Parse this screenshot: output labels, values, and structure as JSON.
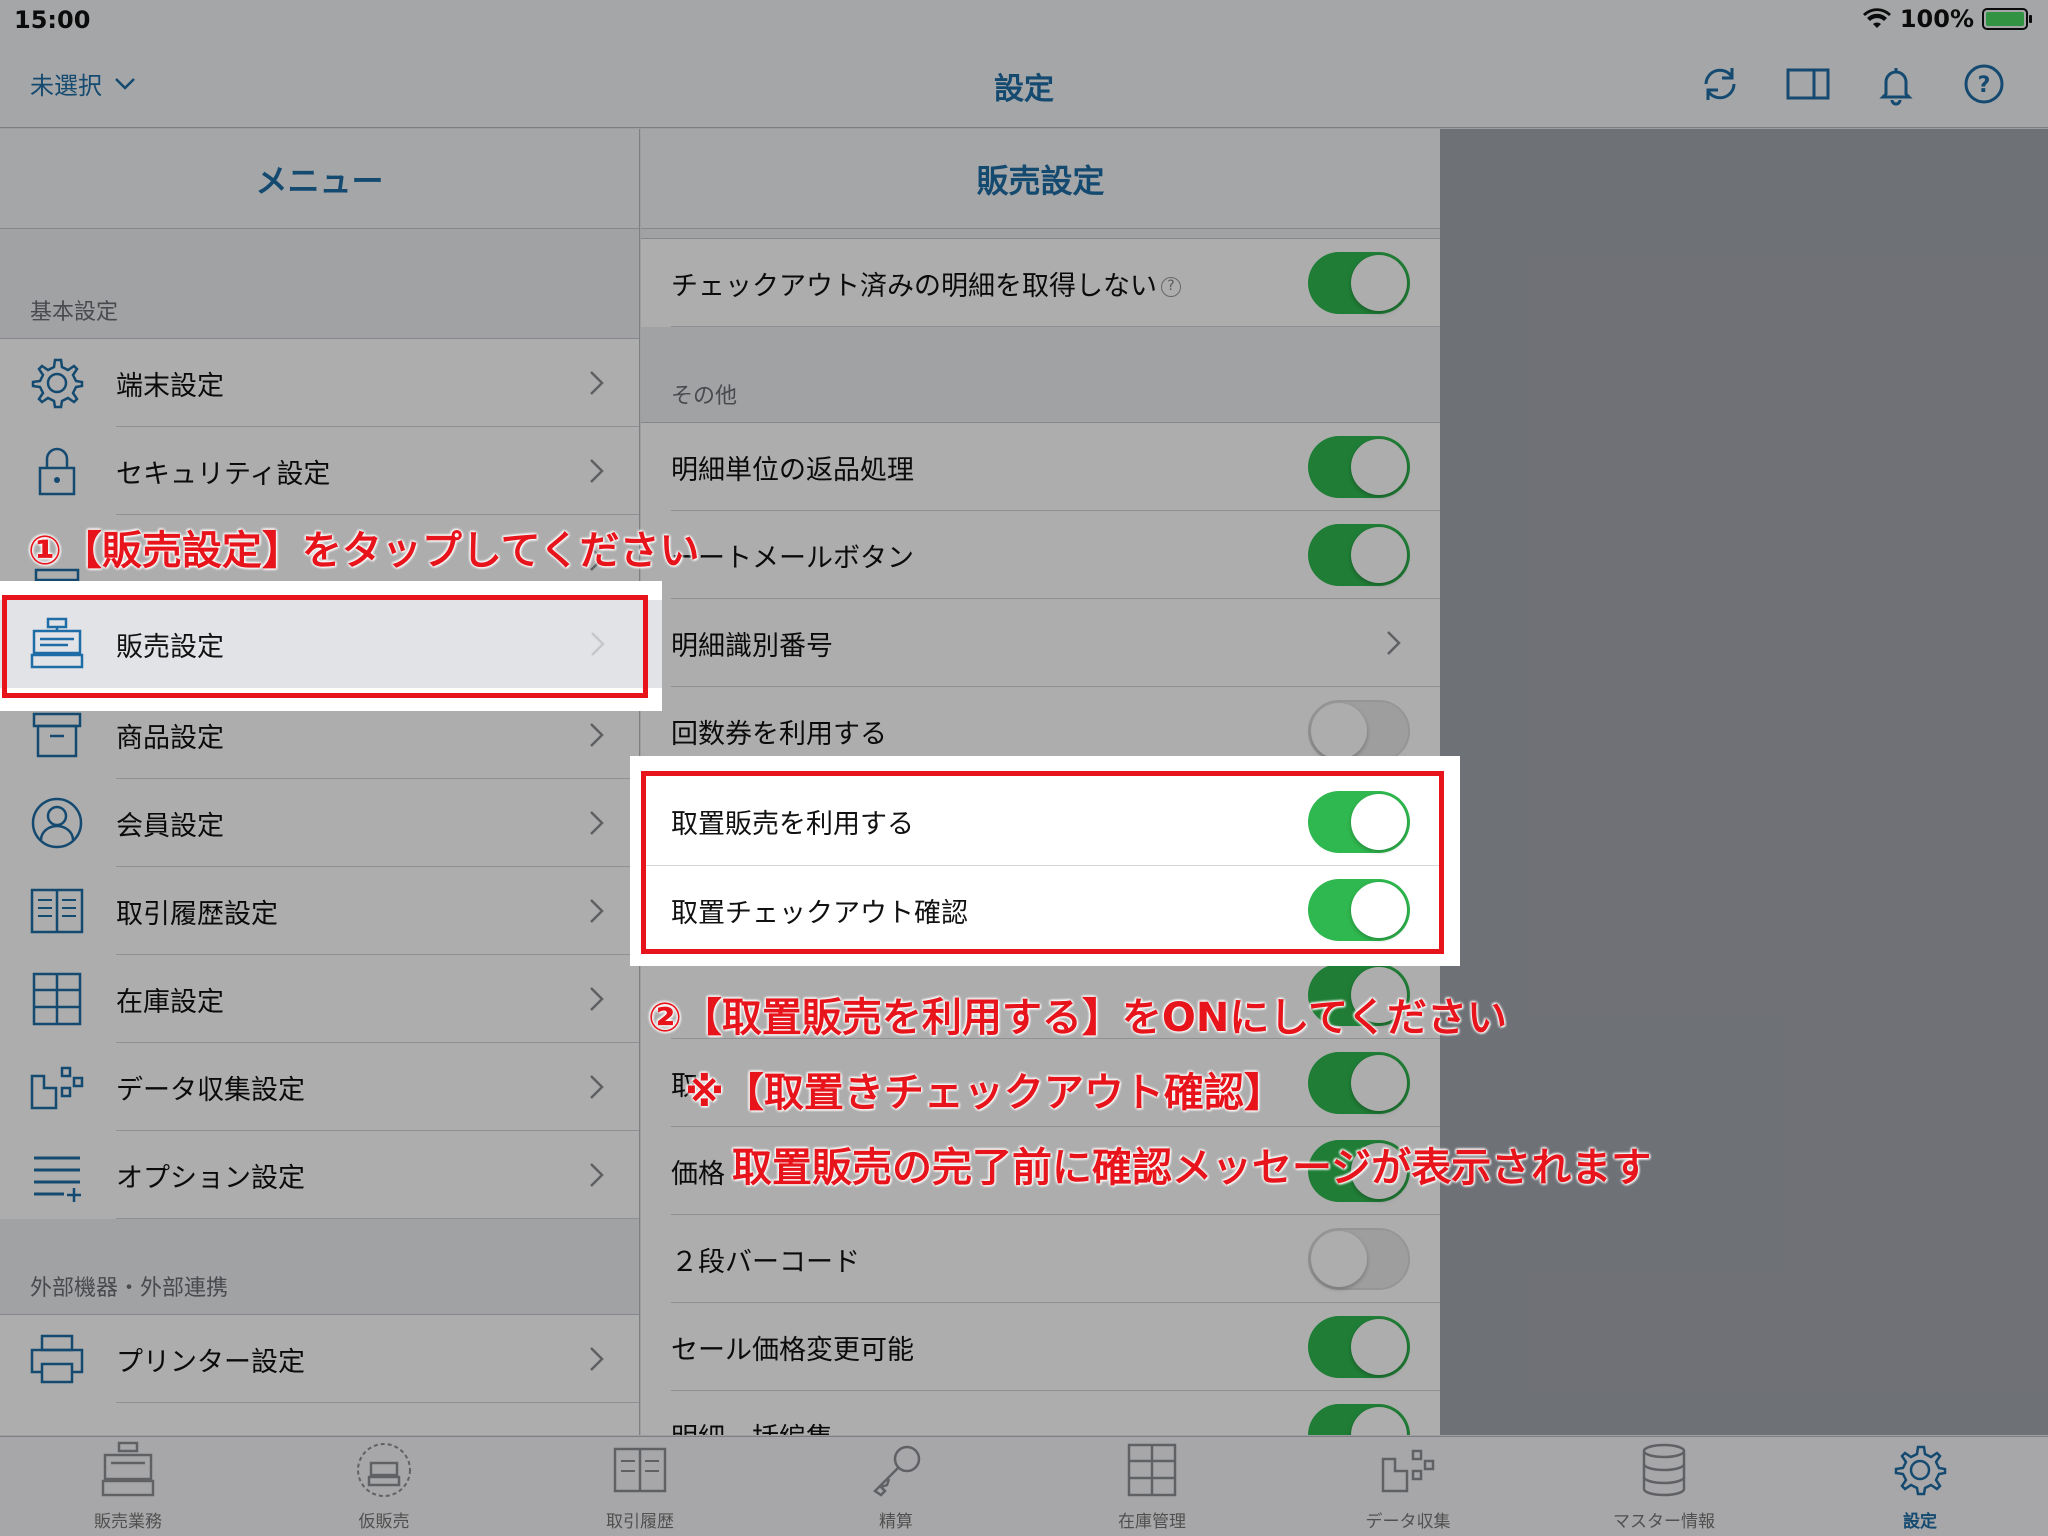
{
  "status": {
    "time": "15:00",
    "battery": "100%"
  },
  "nav": {
    "left_label": "未選択",
    "title": "設定"
  },
  "menu": {
    "header": "メニュー",
    "section_basic": "基本設定",
    "section_external": "外部機器・外部連携",
    "items": [
      {
        "label": "端末設定",
        "icon": "gear-icon"
      },
      {
        "label": "セキュリティ設定",
        "icon": "lock-icon"
      },
      {
        "label": "",
        "icon": "partial-icon"
      },
      {
        "label": "販売設定",
        "icon": "register-icon"
      },
      {
        "label": "商品設定",
        "icon": "box-icon"
      },
      {
        "label": "会員設定",
        "icon": "person-icon"
      },
      {
        "label": "取引履歴設定",
        "icon": "book-icon"
      },
      {
        "label": "在庫設定",
        "icon": "cabinet-icon"
      },
      {
        "label": "データ収集設定",
        "icon": "data-collection-icon"
      },
      {
        "label": "オプション設定",
        "icon": "list-plus-icon"
      }
    ],
    "external_items": [
      {
        "label": "プリンター設定",
        "icon": "printer-icon"
      }
    ]
  },
  "detail": {
    "header": "販売設定",
    "top_row": {
      "label": "チェックアウト済みの明細を取得しない",
      "state": "on"
    },
    "section_other": "その他",
    "rows": [
      {
        "label": "明細単位の返品処理",
        "type": "toggle",
        "state": "on"
      },
      {
        "label": "ーートメールボタン",
        "type": "toggle",
        "state": "on"
      },
      {
        "label": "明細識別番号",
        "type": "chevron"
      },
      {
        "label": "回数券を利用する",
        "type": "toggle",
        "state": "off"
      },
      {
        "label": "取置販売を利用する",
        "type": "toggle",
        "state": "on"
      },
      {
        "label": "取置チェックアウト確認",
        "type": "toggle",
        "state": "on"
      },
      {
        "label": "",
        "type": "toggle",
        "state": "on"
      },
      {
        "label": "取",
        "type": "toggle",
        "state": "on"
      },
      {
        "label": "価格",
        "type": "toggle",
        "state": "on"
      },
      {
        "label": "２段バーコード",
        "type": "toggle",
        "state": "off"
      },
      {
        "label": "セール価格変更可能",
        "type": "toggle",
        "state": "on"
      },
      {
        "label": "明細一括編集",
        "type": "toggle",
        "state": "on"
      }
    ]
  },
  "annotations": {
    "step1": "①【販売設定】をタップしてください",
    "step2": "②【取置販売を利用する】をONにしてください",
    "note1": "※【取置きチェックアウト確認】",
    "note2": "取置販売の完了前に確認メッセージが表示されます"
  },
  "tabs": [
    {
      "label": "販売業務",
      "icon": "register-icon"
    },
    {
      "label": "仮販売",
      "icon": "temp-register-icon"
    },
    {
      "label": "取引履歴",
      "icon": "book-icon"
    },
    {
      "label": "精算",
      "icon": "key-icon"
    },
    {
      "label": "在庫管理",
      "icon": "cabinet-icon"
    },
    {
      "label": "データ収集",
      "icon": "data-collection-icon"
    },
    {
      "label": "マスター情報",
      "icon": "database-icon"
    },
    {
      "label": "設定",
      "icon": "gear-icon",
      "active": true
    }
  ],
  "colors": {
    "accent": "#1f6da6",
    "toggle_on": "#2fb84f",
    "annotation": "#e8141c"
  }
}
